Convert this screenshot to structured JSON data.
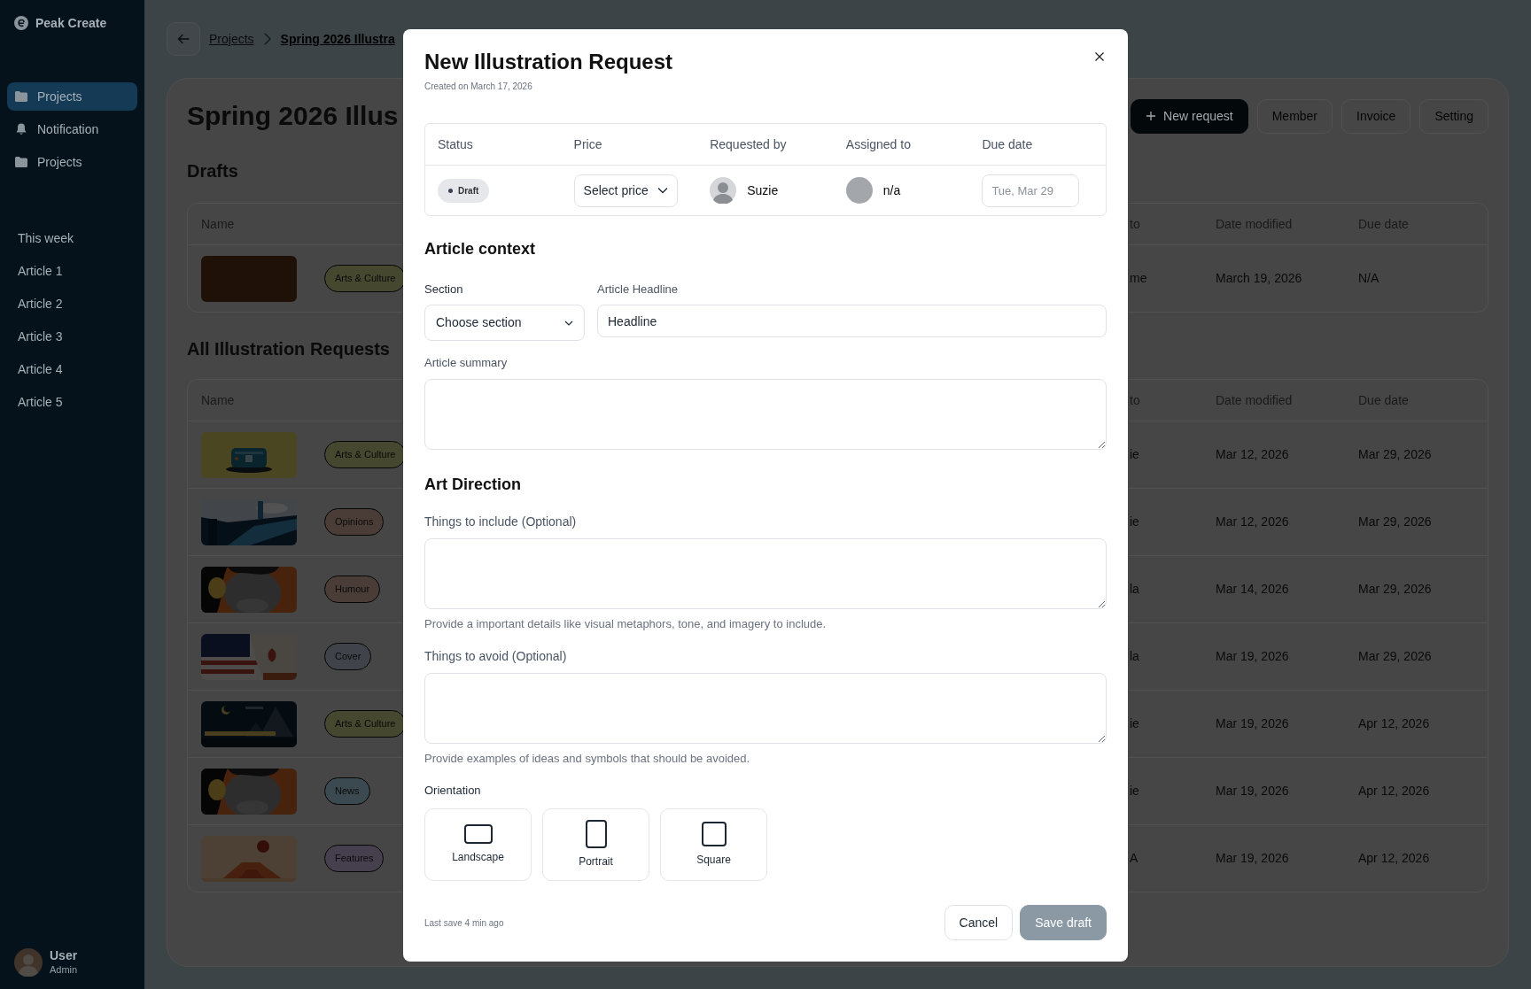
{
  "app": {
    "name": "Peak Create"
  },
  "sidebar": {
    "nav": [
      {
        "label": "Projects",
        "selected": true
      },
      {
        "label": "Notification",
        "selected": false
      },
      {
        "label": "Projects",
        "selected": false
      }
    ],
    "section_title": "This week",
    "articles": [
      "Article 1",
      "Article 2",
      "Article 3",
      "Article 4",
      "Article 5"
    ],
    "user": {
      "name": "User",
      "role": "Admin"
    }
  },
  "breadcrumb": [
    "Projects",
    "Spring 2026 Illustra"
  ],
  "page": {
    "title": "Spring 2026 Illus",
    "actions": [
      {
        "label": "New request",
        "kind": "primary"
      },
      {
        "label": "Member",
        "kind": "outline"
      },
      {
        "label": "Invoice",
        "kind": "outline"
      },
      {
        "label": "Setting",
        "kind": "outline"
      }
    ]
  },
  "drafts": {
    "title": "Drafts",
    "columns": [
      "Name",
      "to",
      "Date modified",
      "Due date"
    ],
    "rows": [
      {
        "thumbnail": {
          "kind": "blank"
        },
        "tag": {
          "label": "Arts & Culture",
          "color": "#45472f"
        },
        "column_3": "me",
        "date_modified": "March 19, 2026",
        "due_date": "N/A"
      }
    ]
  },
  "requests": {
    "title": "All Illustration Requests",
    "columns": [
      "Name",
      "to",
      "Date modified",
      "Due date"
    ],
    "rows": [
      {
        "tag": {
          "label": "Arts & Culture",
          "color": "#45472f"
        },
        "column_3": "ie",
        "date_modified": "Mar 12, 2026",
        "due_date": "Mar 29, 2026"
      },
      {
        "tag": {
          "label": "Opinions",
          "color": "#4a3d38"
        },
        "column_3": "ie",
        "date_modified": "Mar 12, 2026",
        "due_date": "Mar 29, 2026"
      },
      {
        "tag": {
          "label": "Humour",
          "color": "#4a3d38"
        },
        "column_3": "la",
        "date_modified": "Mar 14, 2026",
        "due_date": "Mar 29, 2026"
      },
      {
        "tag": {
          "label": "Cover",
          "color": "#40434a"
        },
        "column_3": "la",
        "date_modified": "Mar 19, 2026",
        "due_date": "Mar 29, 2026"
      },
      {
        "tag": {
          "label": "Arts & Culture",
          "color": "#45472f"
        },
        "column_3": "ie",
        "date_modified": "Mar 19, 2026",
        "due_date": "Apr 12, 2026"
      },
      {
        "tag": {
          "label": "News",
          "color": "#3b4a50"
        },
        "column_3": "ie",
        "date_modified": "Mar 19, 2026",
        "due_date": "Apr 12, 2026"
      },
      {
        "tag": {
          "label": "Features",
          "color": "#463f4e"
        },
        "column_3": "A",
        "date_modified": "Mar 19, 2026",
        "due_date": "Apr 12, 2026"
      }
    ]
  },
  "modal": {
    "title": "New Illustration Request",
    "created": "Created on March 17, 2026",
    "info": {
      "columns": [
        "Status",
        "Price",
        "Requested by",
        "Assigned to",
        "Due date"
      ],
      "status": "Draft",
      "price": "Select price",
      "requested_by": "Suzie",
      "assigned_to": "n/a",
      "due_date_placeholder": "Tue, Mar 29"
    },
    "article_context": {
      "title": "Article context",
      "section_label": "Section",
      "section_value": "Choose section",
      "headline_label": "Article Headline",
      "headline_value": "Headline",
      "summary_label": "Article summary"
    },
    "art_direction": {
      "title": "Art Direction",
      "include_label": "Things to include (Optional)",
      "include_help": "Provide a important details like visual metaphors, tone, and imagery to include.",
      "avoid_label": "Things to avoid (Optional)",
      "avoid_help": "Provide examples of ideas and symbols that should be avoided."
    },
    "orientation": {
      "label": "Orientation",
      "options": [
        {
          "label": "Landscape",
          "kind": "landscape",
          "selected": false
        },
        {
          "label": "Portrait",
          "kind": "portrait",
          "selected": false
        },
        {
          "label": "Square",
          "kind": "square",
          "selected": false
        }
      ]
    },
    "footer": {
      "last_save": "Last save 4 min ago",
      "buttons": [
        {
          "label": "Cancel",
          "kind": "outline"
        },
        {
          "label": "Save draft",
          "kind": "primary"
        }
      ]
    }
  }
}
